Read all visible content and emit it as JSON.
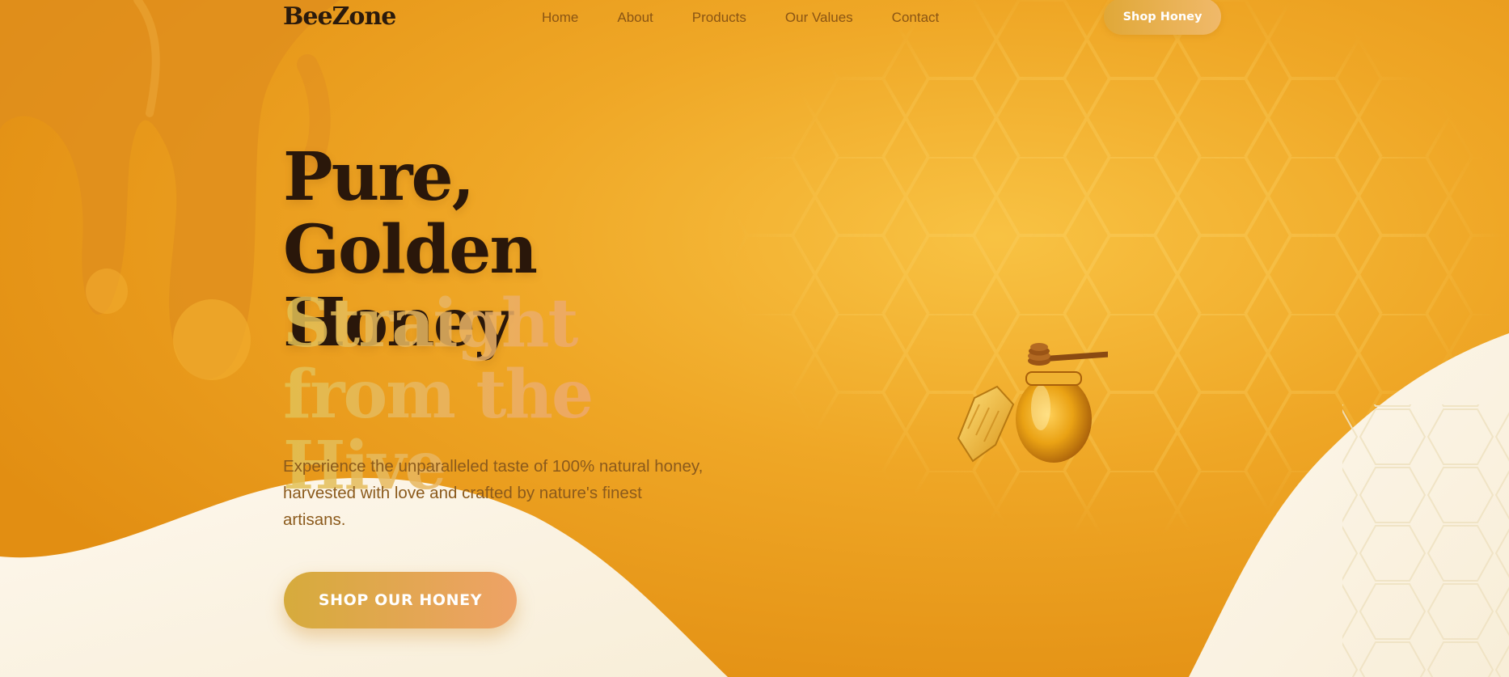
{
  "brand": {
    "name": "BeeZone"
  },
  "nav": {
    "items": [
      {
        "label": "Home"
      },
      {
        "label": "About"
      },
      {
        "label": "Products"
      },
      {
        "label": "Our Values"
      },
      {
        "label": "Contact"
      }
    ],
    "cta_label": "Shop Honey"
  },
  "hero": {
    "headline": "Pure, Golden Honey",
    "subheadline": "Straight from the Hive",
    "description": "Experience the unparalleled taste of 100% natural honey, harvested with love and crafted by nature's finest artisans.",
    "cta_label": "SHOP OUR HONEY"
  },
  "icons": {
    "illustration": "honey-jar-with-dipper-and-honeycomb-icon",
    "pattern": "honeycomb-pattern"
  },
  "colors": {
    "honey": "#eda21c",
    "honey_light": "#f6bc3e",
    "cream": "#fbf3e2",
    "text_dark": "#2a170a",
    "text_brown": "#8b5a1c",
    "nav_link": "#8a5514",
    "button_start": "#d6ab3c",
    "button_end": "#eea266"
  }
}
